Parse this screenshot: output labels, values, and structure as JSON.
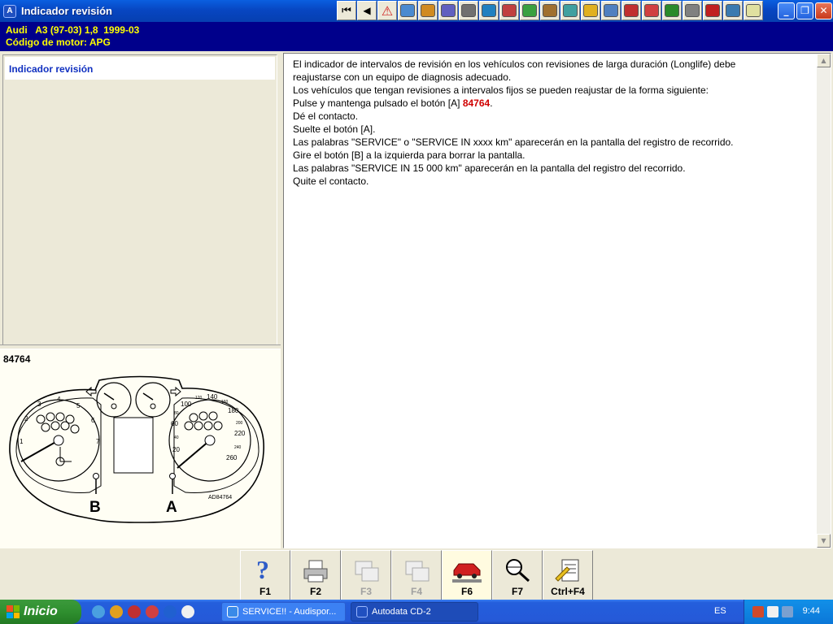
{
  "window": {
    "title": "Indicador revisión",
    "colors": {
      "titlebar": "#0A5FE0",
      "info_bg": "#00008B",
      "info_fg": "#FFFF00",
      "highlight": "#D00000"
    }
  },
  "toolbar_icons": [
    "first-icon",
    "back-icon",
    "warning-icon",
    "map-icon",
    "tools-icon",
    "engine-icon",
    "wheel-icon",
    "spark-icon",
    "battery-icon",
    "door-icon",
    "car-lift-icon",
    "injector-icon",
    "belt-icon",
    "radiator-icon",
    "airbag-icon",
    "brake-icon",
    "service-icon",
    "gauge-icon",
    "hazard-icon",
    "transmission-icon",
    "notes-icon"
  ],
  "vehicle": {
    "line1": "Audi   A3 (97-03) 1,8  1999-03",
    "line2": "Código de motor: APG"
  },
  "topics": [
    {
      "label": "Indicador revisión"
    }
  ],
  "diagram": {
    "number": "84764",
    "code": "AD84764",
    "label_b": "B",
    "label_a": "A",
    "tacho_labels": [
      "1",
      "2",
      "3",
      "4",
      "5",
      "6",
      "7"
    ],
    "speedo_labels": [
      "20",
      "60",
      "100",
      "140",
      "180",
      "220",
      "260"
    ],
    "speedo_small": [
      "40",
      "80",
      "120",
      "160",
      "200",
      "240"
    ]
  },
  "content": {
    "lines": [
      "El indicador de intervalos de revisión en los vehículos con revisiones de larga duración (Longlife) debe",
      "reajustarse con un equipo de diagnosis adecuado.",
      "Los vehículos que tengan revisiones a intervalos fijos se pueden reajustar de la forma siguiente:"
    ],
    "press_prefix": "Pulse y mantenga pulsado el botón [A] ",
    "press_ref": "84764",
    "press_suffix": ".",
    "lines_after": [
      "Dé el contacto.",
      "Suelte el botón [A].",
      "Las palabras \"SERVICE\" o \"SERVICE IN xxxx km\" aparecerán en la pantalla del registro de recorrido.",
      "Gire el botón [B] a la izquierda para borrar la pantalla.",
      "Las palabras \"SERVICE IN 15 000 km\" aparecerán en la pantalla del registro del recorrido.",
      "Quite el contacto."
    ]
  },
  "function_keys": [
    {
      "label": "F1",
      "icon": "help-icon",
      "enabled": true
    },
    {
      "label": "F2",
      "icon": "print-icon",
      "enabled": true
    },
    {
      "label": "F3",
      "icon": "copy-icon",
      "enabled": false
    },
    {
      "label": "F4",
      "icon": "copy-icon",
      "enabled": false
    },
    {
      "label": "F6",
      "icon": "car-icon",
      "enabled": true
    },
    {
      "label": "F7",
      "icon": "search-icon",
      "enabled": true
    },
    {
      "label": "Ctrl+F4",
      "icon": "notes-icon",
      "enabled": true
    }
  ],
  "taskbar": {
    "start_label": "Inicio",
    "tasks": [
      {
        "label": "SERVICE!! - Audispor..."
      },
      {
        "label": "Autodata CD-2"
      }
    ],
    "language": "ES",
    "time": "9:44"
  }
}
